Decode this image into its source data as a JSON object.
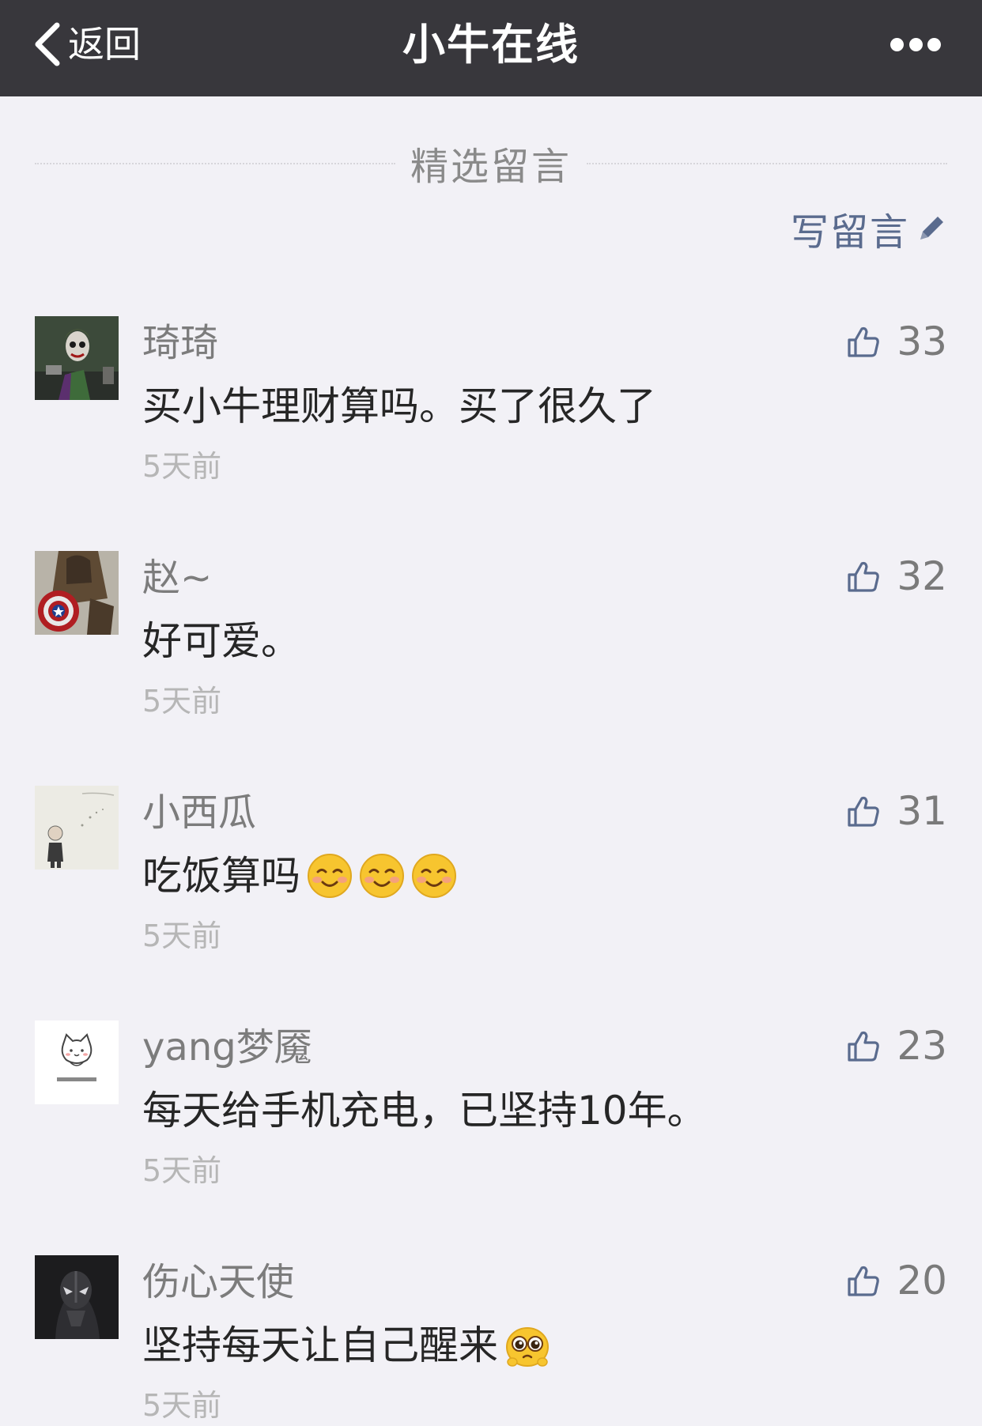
{
  "nav": {
    "back_label": "返回",
    "title": "小牛在线",
    "more_icon": "more-dots-icon"
  },
  "section": {
    "title": "精选留言",
    "write_label": "写留言",
    "write_icon": "pencil-icon"
  },
  "comments": [
    {
      "name": "琦琦",
      "text": "买小牛理财算吗。买了很久了",
      "emojis": 0,
      "emoji_type": "",
      "time": "5天前",
      "likes": "33",
      "avatar": "joker-avatar"
    },
    {
      "name": "赵~",
      "text": "好可爱。",
      "emojis": 0,
      "emoji_type": "",
      "time": "5天前",
      "likes": "32",
      "avatar": "shield-avatar"
    },
    {
      "name": "小西瓜",
      "text": "吃饭算吗",
      "emojis": 3,
      "emoji_type": "blush-emoji",
      "time": "5天前",
      "likes": "31",
      "avatar": "sketch-avatar"
    },
    {
      "name": "yang梦魇",
      "text": "每天给手机充电，已坚持10年。",
      "emojis": 0,
      "emoji_type": "",
      "time": "5天前",
      "likes": "23",
      "avatar": "cat-avatar"
    },
    {
      "name": "伤心天使",
      "text": "坚持每天让自己醒来",
      "emojis": 1,
      "emoji_type": "pleading-emoji",
      "time": "5天前",
      "likes": "20",
      "avatar": "dark-hero-avatar"
    }
  ],
  "colors": {
    "navbar": "#38373c",
    "background": "#f2f1f6",
    "link": "#5a6b8e",
    "emoji": "#f7c52f"
  }
}
